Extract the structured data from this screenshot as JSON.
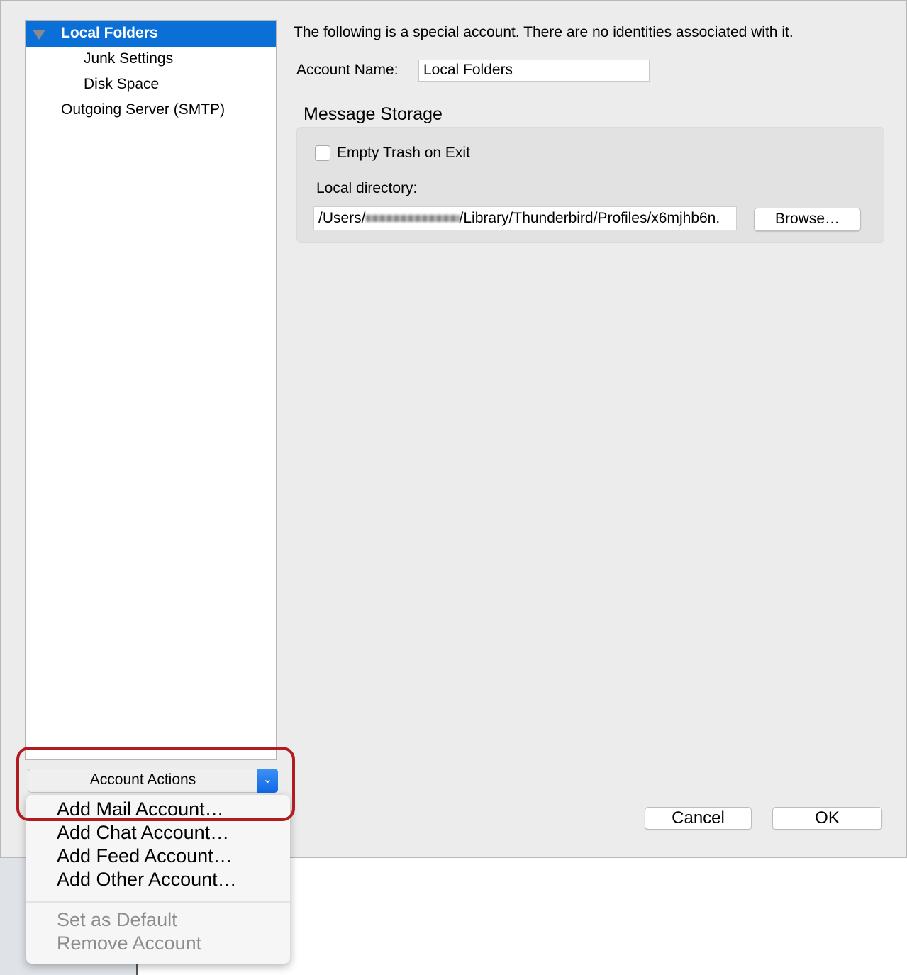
{
  "sidebar": {
    "items": [
      {
        "label": "Local Folders",
        "selected": true,
        "expanded": true
      },
      {
        "label": "Junk Settings"
      },
      {
        "label": "Disk Space"
      },
      {
        "label": "Outgoing Server (SMTP)"
      }
    ]
  },
  "main": {
    "intro": "The following is a special account. There are no identities associated with it.",
    "account_name_label": "Account Name:",
    "account_name_value": "Local Folders",
    "storage_title": "Message Storage",
    "empty_trash_label": "Empty Trash on Exit",
    "empty_trash_checked": false,
    "local_dir_label": "Local directory:",
    "local_dir_prefix": "/Users/",
    "local_dir_suffix": "/Library/Thunderbird/Profiles/x6mjhb6n.",
    "browse_label": "Browse…"
  },
  "account_actions": {
    "label": "Account Actions",
    "icon": "chevron-down-icon",
    "menu": [
      "Add Mail Account…",
      "Add Chat Account…",
      "Add Feed Account…",
      "Add Other Account…"
    ],
    "disabled": [
      "Set as Default",
      "Remove Account"
    ]
  },
  "footer": {
    "cancel": "Cancel",
    "ok": "OK"
  },
  "colors": {
    "selection": "#0b6fd8",
    "highlight": "#b01c22"
  }
}
